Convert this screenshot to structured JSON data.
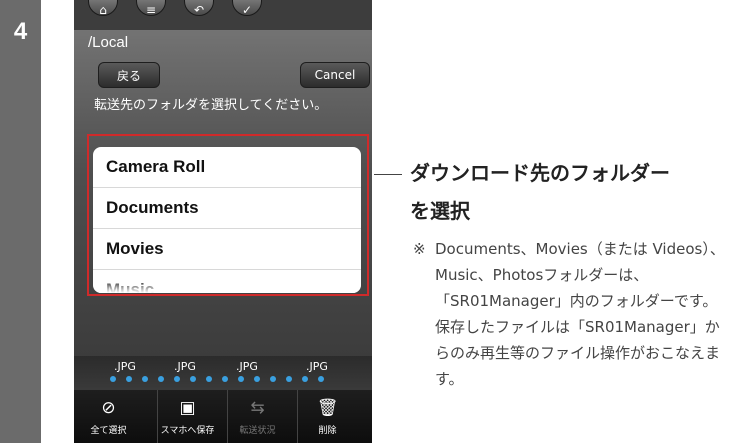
{
  "step": {
    "number": "4"
  },
  "phone": {
    "path": "/Local",
    "back_label": "戻る",
    "cancel_label": "Cancel",
    "instruction": "転送先のフォルダを選択してください。",
    "folders": [
      "Camera Roll",
      "Documents",
      "Movies",
      "Music"
    ],
    "thumbnails": [
      ".JPG",
      ".JPG",
      ".JPG",
      ".JPG"
    ],
    "toolbar": [
      {
        "label": "全て選択",
        "icon": "check-circle-icon"
      },
      {
        "label": "スマホへ保存",
        "icon": "save-to-phone-icon"
      },
      {
        "label": "転送状況",
        "icon": "transfer-status-icon"
      },
      {
        "label": "削除",
        "icon": "trash-icon"
      }
    ]
  },
  "annotation": {
    "heading_line1": "ダウンロード先のフォルダー",
    "heading_line2": "を選択",
    "note_mark": "※",
    "note_text": "Documents、Movies（または Videos）、Music、Photosフォルダーは、「SR01Manager」内のフォルダーです。保存したファイルは「SR01Manager」からのみ再生等のファイル操作がおこなえます。"
  },
  "colors": {
    "highlight": "#d02a2a",
    "step_strip": "#6b6b6b",
    "dot": "#3aa0e0"
  }
}
